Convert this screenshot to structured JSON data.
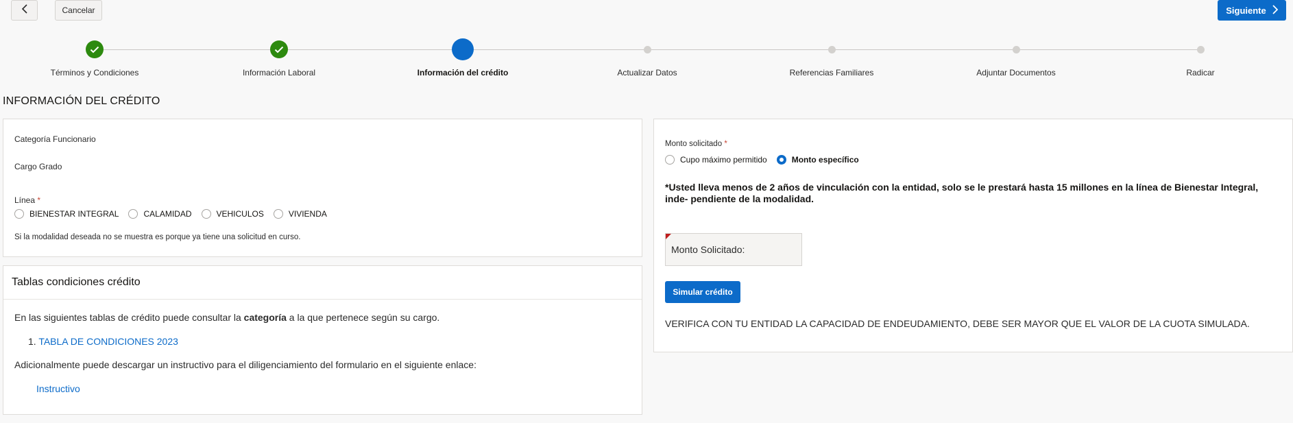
{
  "toolbar": {
    "back_icon": "chevron-left-icon",
    "cancel_label": "Cancelar",
    "next_label": "Siguiente",
    "next_icon": "chevron-right-icon",
    "accent": "#0c6bc9"
  },
  "stepper": {
    "steps": [
      {
        "label": "Términos y Condiciones",
        "status": "complete"
      },
      {
        "label": "Información Laboral",
        "status": "complete"
      },
      {
        "label": "Información del crédito",
        "status": "current"
      },
      {
        "label": "Actualizar Datos",
        "status": "pending"
      },
      {
        "label": "Referencias Familiares",
        "status": "pending"
      },
      {
        "label": "Adjuntar Documentos",
        "status": "pending"
      },
      {
        "label": "Radicar",
        "status": "pending"
      }
    ],
    "complete_color": "#2d8a0f"
  },
  "page": {
    "title": "INFORMACIÓN DEL CRÉDITO"
  },
  "left_form": {
    "categoria_label": "Categoría Funcionario",
    "cargo_label": "Cargo Grado",
    "linea_label": "Línea",
    "required_mark": "*",
    "linea_options": [
      "BIENESTAR INTEGRAL",
      "CALAMIDAD",
      "VEHICULOS",
      "VIVIENDA"
    ],
    "linea_note": "Si la modalidad deseada no se muestra es porque ya tiene una solicitud en curso."
  },
  "tables_panel": {
    "title": "Tablas condiciones crédito",
    "intro_before": "En las siguientes tablas de crédito puede consultar la ",
    "intro_bold": "categoría",
    "intro_after": " a la que pertenece según su cargo.",
    "list_number": "1.",
    "table_link": "TABLA DE CONDICIONES 2023",
    "additional": "Adicionalmente puede descargar un instructivo para el diligenciamiento del formulario en el siguiente enlace:",
    "instructivo_link": "Instructivo"
  },
  "right_form": {
    "monto_label": "Monto solicitado",
    "required_mark": "*",
    "options": [
      {
        "label": "Cupo máximo permitido",
        "selected": false
      },
      {
        "label": "Monto específico",
        "selected": true
      }
    ],
    "warning": "*Usted lleva menos de 2 años de vinculación con la entidad, solo se le prestará hasta 15 millones en la línea de Bienestar Integral, inde- pendiente de la modalidad.",
    "monto_field_label": "Monto Solicitado:",
    "simular_label": "Simular crédito",
    "verify_note": "VERIFICA CON TU ENTIDAD LA CAPACIDAD DE ENDEUDAMIENTO, DEBE SER MAYOR QUE EL VALOR DE LA CUOTA SIMULADA."
  }
}
